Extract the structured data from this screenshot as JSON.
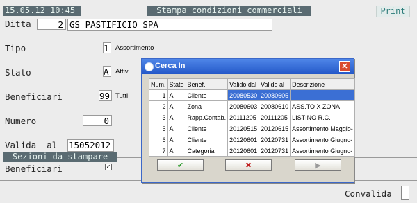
{
  "header": {
    "datetime": "15.05.12 10:45",
    "title": "Stampa condizioni commerciali",
    "print": "Print"
  },
  "form": {
    "ditta": {
      "label": "Ditta",
      "code": "2",
      "name": "GS PASTIFICIO SPA"
    },
    "tipo": {
      "label": "Tipo",
      "value": "1",
      "desc": "Assortimento"
    },
    "stato": {
      "label": "Stato",
      "value": "A",
      "desc": "Attivi"
    },
    "beneficiari": {
      "label": "Beneficiari",
      "value": "99",
      "desc": "Tutti"
    },
    "numero": {
      "label": "Numero",
      "value": "0"
    },
    "valida": {
      "label": "Valida  al",
      "value": "15052012"
    },
    "sezioni": {
      "label": "Sezioni da stampare"
    },
    "beneficiari_check": {
      "label": "Beneficiari",
      "checked": "✓"
    },
    "convalida": {
      "label": "Convalida"
    }
  },
  "dialog": {
    "title": "Cerca In",
    "close": "✕",
    "columns": [
      "Num.",
      "Stato",
      "Benef.",
      "Valido dal",
      "Valido al",
      "Descrizione"
    ],
    "rows": [
      [
        "1",
        "A",
        "Cliente",
        "20080530",
        "20080605",
        ""
      ],
      [
        "2",
        "A",
        "Zona",
        "20080603",
        "20080610",
        "ASS.TO X ZONA"
      ],
      [
        "3",
        "A",
        "Rapp.Contab.",
        "20111205",
        "20111205",
        "LISTINO R.C."
      ],
      [
        "5",
        "A",
        "Cliente",
        "20120515",
        "20120615",
        "Assortimento Maggio-"
      ],
      [
        "6",
        "A",
        "Cliente",
        "20120601",
        "20120731",
        "Assortimento Giugno-"
      ],
      [
        "7",
        "A",
        "Categoria",
        "20120601",
        "20120731",
        "Assortimento Giugno-"
      ]
    ],
    "buttons": {
      "ok": "✔",
      "cancel": "✖",
      "next": "▶"
    }
  }
}
